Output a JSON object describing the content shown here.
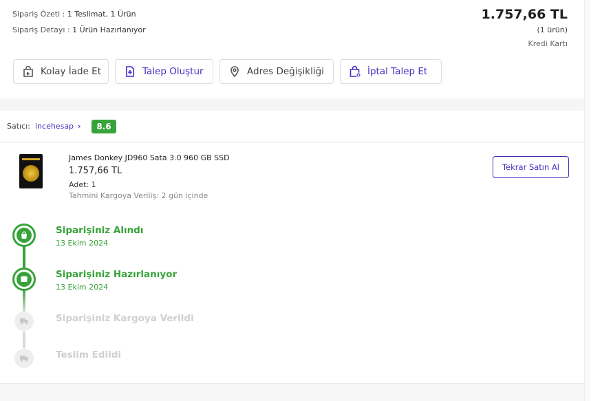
{
  "summary": {
    "overview_label": "Sipariş Özeti :",
    "overview_value": "1 Teslimat, 1 Ürün",
    "detail_label": "Sipariş Detayı :",
    "detail_value": "1 Ürün Hazırlanıyor",
    "total": "1.757,66 TL",
    "item_count": "(1 ürün)",
    "payment_method": "Kredi Kartı"
  },
  "actions": {
    "easy_return": "Kolay İade Et",
    "create_request": "Talep Oluştur",
    "address_change": "Adres Değişikliği",
    "cancel_request": "İptal Talep Et"
  },
  "seller": {
    "label": "Satıcı:",
    "name": "incehesap",
    "chevron": "›",
    "score": "8.6"
  },
  "product": {
    "title": "James Donkey JD960 Sata 3.0 960 GB SSD",
    "price": "1.757,66 TL",
    "quantity": "Adet: 1",
    "shipping_eta": "Tahmini Kargoya Veriliş: 2 gün içinde",
    "rebuy_label": "Tekrar Satın Al"
  },
  "timeline": {
    "steps": [
      {
        "title": "Siparişiniz Alındı",
        "date": "13 Ekim 2024",
        "status": "done",
        "icon": "shopping-bag-icon"
      },
      {
        "title": "Siparişiniz Hazırlanıyor",
        "date": "13 Ekim 2024",
        "status": "done",
        "icon": "package-icon"
      },
      {
        "title": "Siparişiniz Kargoya Verildi",
        "date": "",
        "status": "pending",
        "icon": "truck-icon"
      },
      {
        "title": "Teslim Edildi",
        "date": "",
        "status": "pending",
        "icon": "delivery-icon"
      }
    ]
  },
  "colors": {
    "accent_purple": "#4a2bc2",
    "success_green": "#37a33a",
    "pending_gray": "#cfcfcf"
  }
}
